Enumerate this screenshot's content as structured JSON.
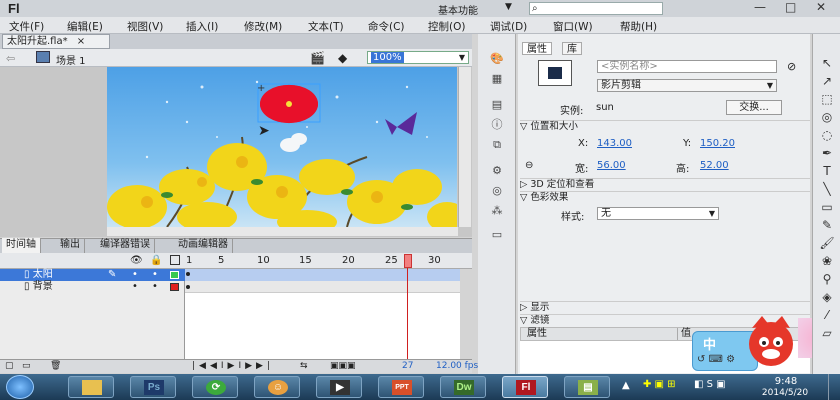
{
  "app": {
    "logo": "Fl",
    "workspace": "基本功能",
    "workspace_arrow": "▼",
    "search_placeholder": ""
  },
  "window_buttons": {
    "min": "—",
    "max": "□",
    "close": "✕"
  },
  "menu": [
    "文件(F)",
    "编辑(E)",
    "视图(V)",
    "插入(I)",
    "修改(M)",
    "文本(T)",
    "命令(C)",
    "控制(O)",
    "调试(D)",
    "窗口(W)",
    "帮助(H)"
  ],
  "document": {
    "tab": "太阳升起.fla*",
    "tab_close": "×",
    "scene": "场景 1",
    "zoom": "100%"
  },
  "timeline": {
    "tabs": [
      "时间轴",
      "输出",
      "编译器错误",
      "动画编辑器"
    ],
    "ruler": [
      "1",
      "5",
      "10",
      "15",
      "20",
      "25",
      "30"
    ],
    "layers": [
      {
        "name": "太阳",
        "selected": true,
        "color": "#36c850"
      },
      {
        "name": "背景",
        "selected": false,
        "color": "#e02020"
      }
    ],
    "current_frame": "27",
    "fps": "12.00 fps",
    "playhead_frame": 27
  },
  "properties": {
    "tabs": [
      "属性",
      "库"
    ],
    "instance_name_placeholder": "<实例名称>",
    "symbol_type": "影片剪辑",
    "instance_label": "实例:",
    "instance_value": "sun",
    "swap_button": "交换...",
    "section_position": "位置和大小",
    "x_label": "X:",
    "x_value": "143.00",
    "y_label": "Y:",
    "y_value": "150.20",
    "w_label": "宽:",
    "w_value": "56.00",
    "h_label": "高:",
    "h_value": "52.00",
    "section_3d": "3D 定位和查看",
    "section_color": "色彩效果",
    "style_label": "样式:",
    "style_value": "无",
    "section_display": "显示",
    "section_filter": "滤镜",
    "filter_col1": "属性",
    "filter_col2": "值"
  },
  "ime": {
    "label": "中"
  },
  "taskbar": {
    "apps": [
      "Ps",
      "⟳",
      "☺",
      "▶",
      "PPT",
      "Dw",
      "Fl",
      "▤"
    ],
    "time": "9:48",
    "date": "2014/5/20"
  },
  "colors": {
    "accent": "#1f5fc4",
    "sun": "#e8102a",
    "sky": "#4da0e6",
    "flash_red": "#b01820"
  }
}
